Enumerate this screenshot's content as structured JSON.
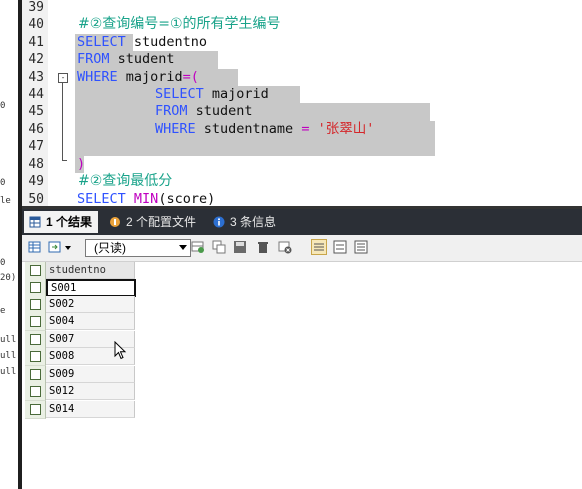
{
  "left_strip": {
    "fragments": [
      "0",
      "0",
      "le",
      "0",
      "20)",
      "e",
      "ull",
      "ull",
      "ull"
    ]
  },
  "editor": {
    "line_numbers": [
      "39",
      "40",
      "41",
      "42",
      "43",
      "44",
      "45",
      "46",
      "47",
      "48",
      "49",
      "50"
    ],
    "line40_comment": "#②查询编号=①的所有学生编号",
    "line41": {
      "kw": "SELECT",
      "rest": " studentno"
    },
    "line42": {
      "kw": "FROM",
      "rest": " student"
    },
    "line43": {
      "kw": "WHERE",
      "rest": " majorid",
      "op": "=(",
      "fold": "-"
    },
    "line44": {
      "kw": "SELECT",
      "rest": " majorid"
    },
    "line45": {
      "kw": "FROM",
      "rest": " student"
    },
    "line46": {
      "kw": "WHERE",
      "rest": " studentname ",
      "op": "=",
      "str": "'张翠山'"
    },
    "line48": {
      "op": ")"
    },
    "line49_comment": "#②查询最低分",
    "line50": {
      "kw": "SELECT",
      "fn": "MIN",
      "rest": "(score)"
    }
  },
  "tabs": [
    {
      "label": "1 个结果",
      "icon": "result-grid-icon"
    },
    {
      "label": "2 个配置文件",
      "icon": "profile-icon"
    },
    {
      "label": "3 条信息",
      "icon": "info-icon"
    }
  ],
  "toolbar": {
    "mode_select": "(只读)"
  },
  "result_table": {
    "column": "studentno",
    "rows": [
      "S001",
      "S002",
      "S004",
      "S007",
      "S008",
      "S009",
      "S012",
      "S014"
    ]
  }
}
